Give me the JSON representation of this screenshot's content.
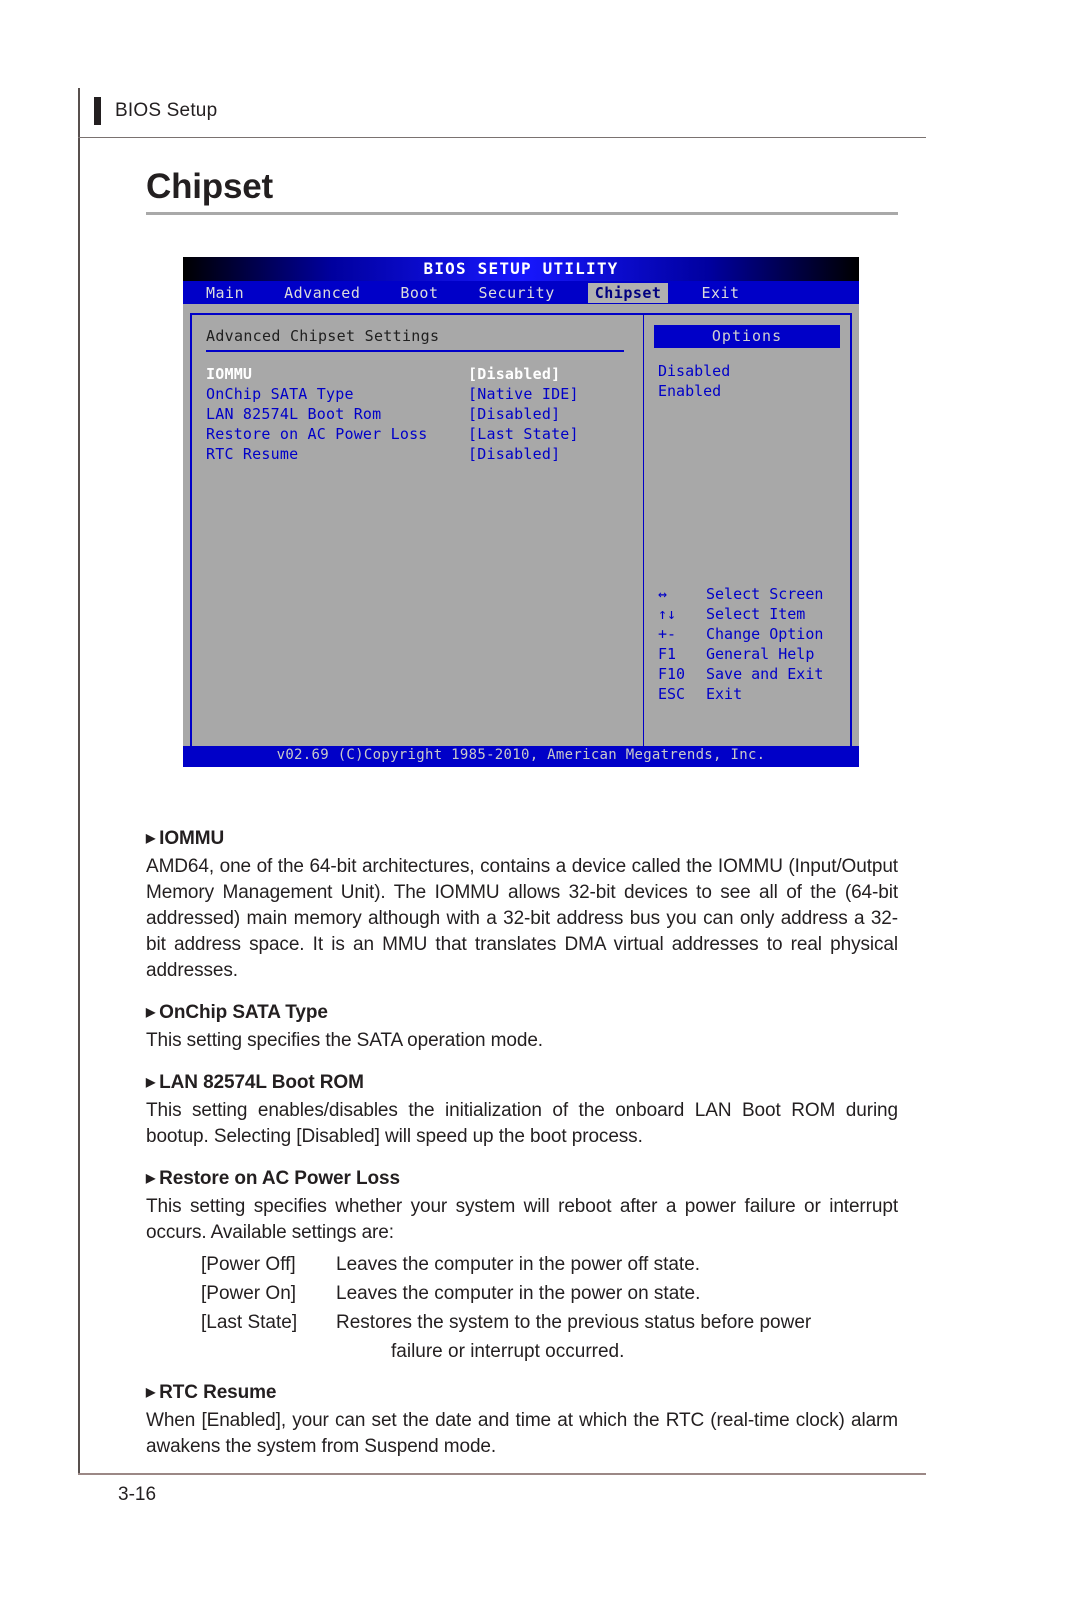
{
  "running_head": "BIOS Setup",
  "page_title": "Chipset",
  "page_number": "3-16",
  "bios": {
    "utility_title": "BIOS SETUP UTILITY",
    "menu": [
      {
        "label": "Main",
        "active": false
      },
      {
        "label": "Advanced",
        "active": false
      },
      {
        "label": "Boot",
        "active": false
      },
      {
        "label": "Security",
        "active": false
      },
      {
        "label": "Chipset",
        "active": true
      },
      {
        "label": "Exit",
        "active": false
      }
    ],
    "section_heading": "Advanced Chipset Settings",
    "settings": [
      {
        "label": "IOMMU",
        "value": "[Disabled]",
        "selected": true
      },
      {
        "label": "OnChip SATA Type",
        "value": "[Native IDE]",
        "selected": false
      },
      {
        "label": "LAN 82574L Boot Rom",
        "value": "[Disabled]",
        "selected": false
      },
      {
        "label": "Restore on AC Power Loss",
        "value": "[Last State]",
        "selected": false
      },
      {
        "label": "RTC Resume",
        "value": "[Disabled]",
        "selected": false
      }
    ],
    "options_header": "Options",
    "options": [
      "Disabled",
      "Enabled"
    ],
    "keys": [
      {
        "key": "↔",
        "desc": "Select Screen"
      },
      {
        "key": "↑↓",
        "desc": "Select Item"
      },
      {
        "key": "+-",
        "desc": "Change Option"
      },
      {
        "key": "F1",
        "desc": "General Help"
      },
      {
        "key": "F10",
        "desc": "Save and Exit"
      },
      {
        "key": "ESC",
        "desc": "Exit"
      }
    ],
    "footer": "v02.69 (C)Copyright 1985-2010, American Megatrends, Inc.",
    "colors": {
      "panel_bg": "#a8a8a8",
      "blue": "#0000c8",
      "highlight": "#b0b0b0"
    }
  },
  "sections": {
    "iommu": {
      "heading": "IOMMU",
      "body": "AMD64, one of the 64-bit architectures, contains a device called the IOMMU (Input/Output Memory Management Unit). The IOMMU allows 32-bit devices to see all of the (64-bit addressed) main memory although with a 32-bit address bus you can only address a 32-bit address space. It is an MMU that translates DMA virtual addresses to real physical addresses."
    },
    "onchip_sata": {
      "heading": "OnChip SATA Type",
      "body": "This setting specifies the SATA operation mode."
    },
    "lan_boot_rom": {
      "heading": "LAN 82574L Boot ROM",
      "body": "This setting enables/disables the initialization of the onboard LAN Boot ROM during bootup. Selecting [Disabled] will speed up the boot process."
    },
    "restore_ac": {
      "heading": "Restore on AC Power Loss",
      "body": "This setting specifies whether your system will reboot after a power failure or interrupt occurs. Available settings are:",
      "options": [
        {
          "key": "[Power Off]",
          "desc": "Leaves the computer in the power off state.",
          "cont": ""
        },
        {
          "key": "[Power On]",
          "desc": "Leaves the computer in the power on state.",
          "cont": ""
        },
        {
          "key": "[Last State]",
          "desc": "Restores the system to the previous status before power",
          "cont": "failure or interrupt occurred."
        }
      ]
    },
    "rtc_resume": {
      "heading": "RTC Resume",
      "body": "When [Enabled], your can set the date and time at which the RTC (real-time clock) alarm awakens the system from Suspend mode."
    }
  }
}
